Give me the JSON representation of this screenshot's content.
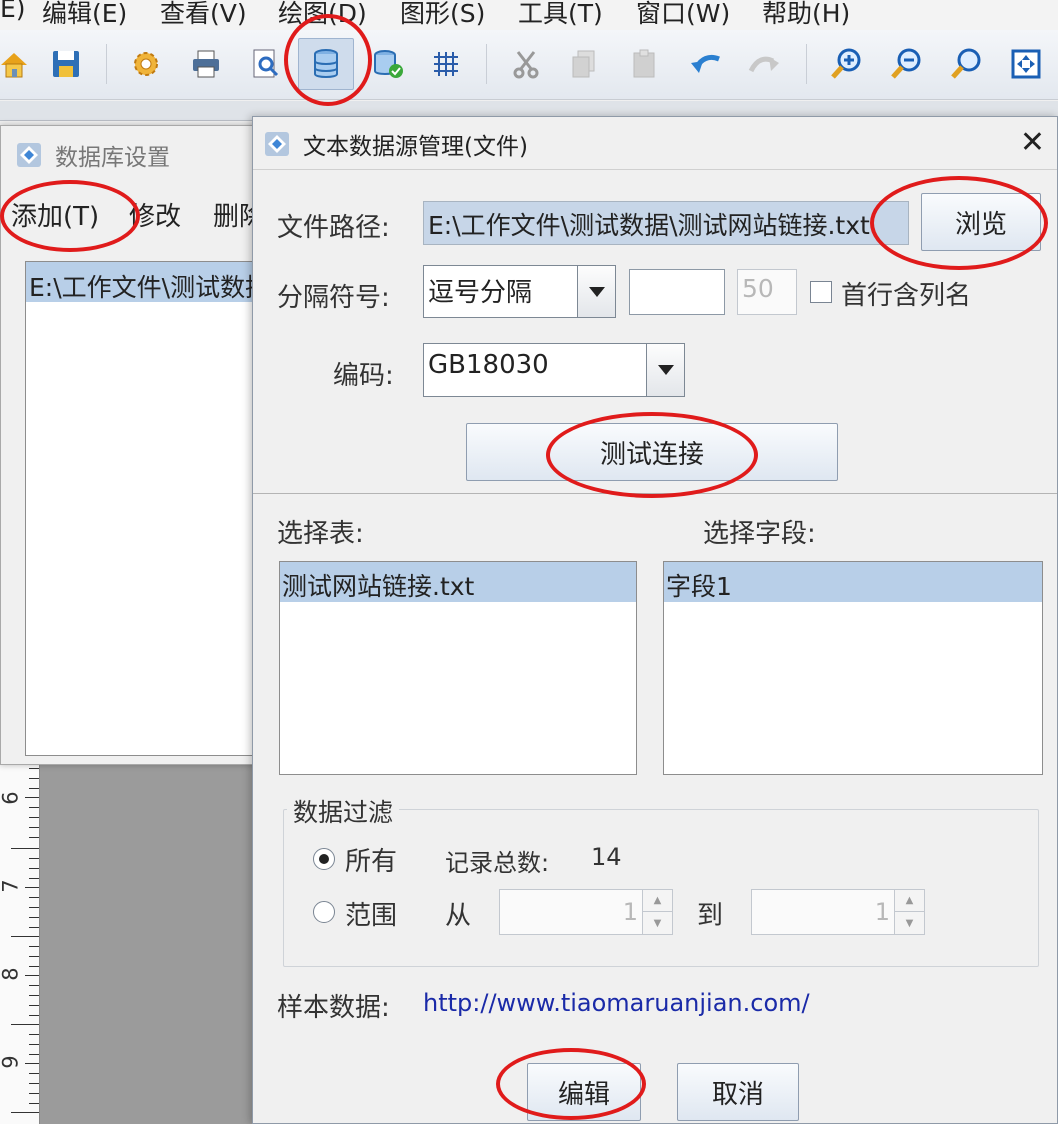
{
  "menubar": {
    "items": [
      "E)",
      "编辑(E)",
      "查看(V)",
      "绘图(D)",
      "图形(S)",
      "工具(T)",
      "窗口(W)",
      "帮助(H)"
    ]
  },
  "toolbar": {
    "icons": [
      "home-icon",
      "save-icon",
      "settings-gear-icon",
      "print-icon",
      "print-preview-icon",
      "database-icon",
      "database-add-icon",
      "grid-icon",
      "cut-icon",
      "copy-icon",
      "paste-icon",
      "undo-icon",
      "redo-icon",
      "zoom-in-icon",
      "zoom-out-icon",
      "zoom-icon",
      "fit-page-icon"
    ]
  },
  "ruler": {
    "labels": [
      "6",
      "7",
      "8",
      "9"
    ]
  },
  "db_settings_dialog": {
    "title": "数据库设置",
    "menu": {
      "add": "添加(T)",
      "modify": "修改",
      "delete": "删除"
    },
    "list_items": [
      "E:\\工作文件\\测试数据\\测试网站链接.txt"
    ]
  },
  "text_source_dialog": {
    "title": "文本数据源管理(文件)",
    "close_symbol": "✕",
    "file_path_label": "文件路径:",
    "file_path_value": "E:\\工作文件\\测试数据\\测试网站链接.txt",
    "browse_label": "浏览",
    "separator_label": "分隔符号:",
    "separator_value": "逗号分隔",
    "custom_separator_value": "",
    "column_count_value": "50",
    "first_row_header_label": "首行含列名",
    "encoding_label": "编码:",
    "encoding_value": "GB18030",
    "test_connection_label": "测试连接",
    "select_table_label": "选择表:",
    "tables": [
      "测试网站链接.txt"
    ],
    "select_field_label": "选择字段:",
    "fields": [
      "字段1"
    ],
    "filter": {
      "title": "数据过滤",
      "all_label": "所有",
      "total_records_label": "记录总数:",
      "total_records_value": "14",
      "range_label": "范围",
      "from_label": "从",
      "from_value": "1",
      "to_label": "到",
      "to_value": "1"
    },
    "sample_label": "样本数据:",
    "sample_value": "http://www.tiaomaruanjian.com/",
    "edit_label": "编辑",
    "cancel_label": "取消"
  },
  "colors": {
    "highlight_ring": "#e01b1b",
    "selection": "#b8cfe8",
    "link": "#1a2aa8"
  }
}
